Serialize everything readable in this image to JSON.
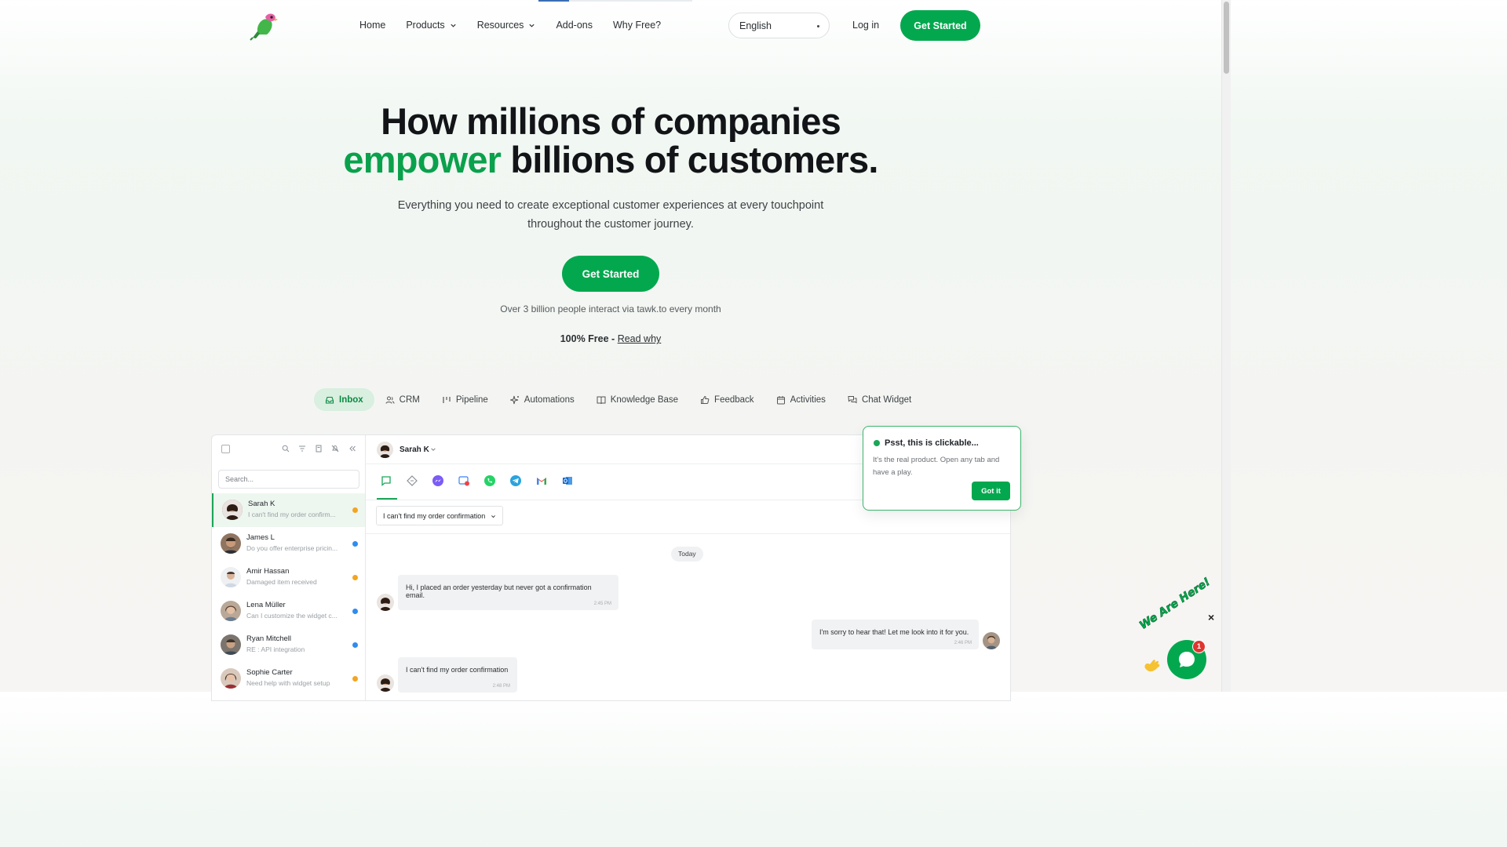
{
  "header": {
    "logo_alt": "tawk.to parrot logo",
    "nav": [
      {
        "label": "Home",
        "dropdown": false
      },
      {
        "label": "Products",
        "dropdown": true
      },
      {
        "label": "Resources",
        "dropdown": true
      },
      {
        "label": "Add-ons",
        "dropdown": false
      },
      {
        "label": "Why Free?",
        "dropdown": false
      }
    ],
    "language": "English",
    "login": "Log in",
    "cta": "Get Started"
  },
  "hero": {
    "title_line1": "How millions of companies",
    "title_green": "empower",
    "title_line2_rest": " billions of customers.",
    "subtitle": "Everything you need to create exceptional customer experiences at every touchpoint throughout the customer journey.",
    "cta": "Get Started",
    "stat": "Over 3 billion people interact via tawk.to every month",
    "free_bold": "100% Free - ",
    "free_link": "Read why"
  },
  "tabs": [
    {
      "label": "Inbox",
      "icon": "inbox-icon",
      "active": true
    },
    {
      "label": "CRM",
      "icon": "users-icon",
      "active": false
    },
    {
      "label": "Pipeline",
      "icon": "pipeline-icon",
      "active": false
    },
    {
      "label": "Automations",
      "icon": "sparkle-icon",
      "active": false
    },
    {
      "label": "Knowledge Base",
      "icon": "book-icon",
      "active": false
    },
    {
      "label": "Feedback",
      "icon": "thumbs-up-icon",
      "active": false
    },
    {
      "label": "Activities",
      "icon": "calendar-icon",
      "active": false
    },
    {
      "label": "Chat Widget",
      "icon": "chat-icon",
      "active": false
    }
  ],
  "inbox": {
    "search_placeholder": "Search...",
    "conversations": [
      {
        "name": "Sarah K",
        "preview": "I can't find my order confirm...",
        "status_color": "#f2a520",
        "avatar_color": "#6b4a3a"
      },
      {
        "name": "James L",
        "preview": "Do you offer enterprise pricin...",
        "status_color": "#2f8cf0",
        "avatar_color": "#7b5a44"
      },
      {
        "name": "Amir Hassan",
        "preview": "Damaged item received",
        "status_color": "#f2a520",
        "avatar_color": "#c9cdd2"
      },
      {
        "name": "Lena Müller",
        "preview": "Can I customize the widget c...",
        "status_color": "#2f8cf0",
        "avatar_color": "#9a7a62"
      },
      {
        "name": "Ryan Mitchell",
        "preview": "RE : API integration",
        "status_color": "#2f8cf0",
        "avatar_color": "#5f5a55"
      },
      {
        "name": "Sophie Carter",
        "preview": "Need help with widget setup",
        "status_color": "#f2a520",
        "avatar_color": "#8a3a3a"
      }
    ],
    "chat_contact": "Sarah K",
    "subject": "I can't find my order confirmation",
    "day_label": "Today",
    "messages": [
      {
        "text": "Hi, I placed an order yesterday but never got a confirmation email.",
        "time": "2:45 PM",
        "from": "visitor"
      },
      {
        "text": "I'm sorry to hear that! Let me look into it for you.",
        "time": "2:46 PM",
        "from": "agent"
      },
      {
        "text": "I can't find my order confirmation",
        "time": "2:48 PM",
        "from": "visitor"
      }
    ]
  },
  "popover": {
    "title": "Psst, this is clickable...",
    "text": "It's the real product. Open any tab and have a play.",
    "button": "Got it"
  },
  "widget": {
    "label": "We Are Here!",
    "badge": "1",
    "close": "×"
  },
  "colors": {
    "brand_green": "#03a84e",
    "accent_green": "#0aa14c"
  }
}
